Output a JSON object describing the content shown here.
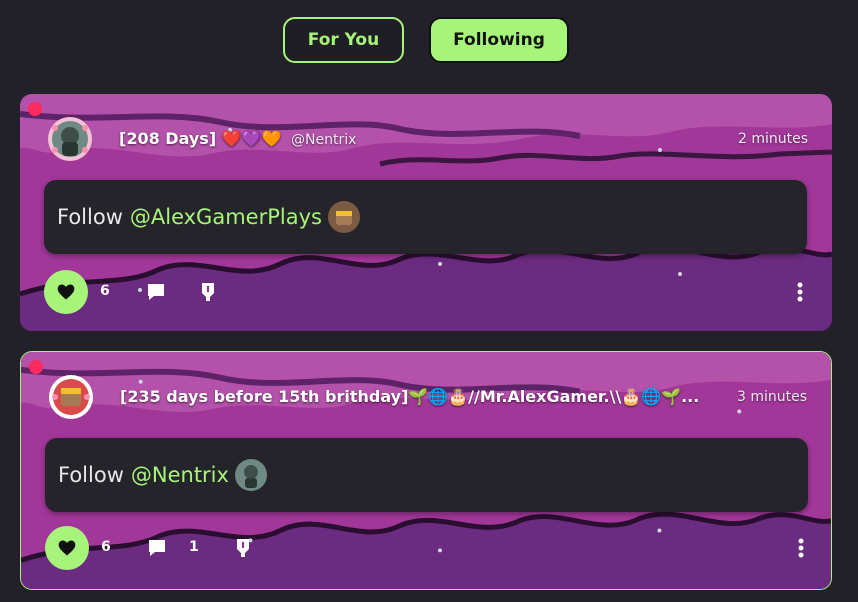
{
  "tabs": [
    {
      "label": "For You"
    },
    {
      "label": "Following"
    }
  ],
  "posts": [
    {
      "username": "[208 Days] ❤️💜🧡",
      "handle": "@Nentrix",
      "time": "2 minutes",
      "content_prefix": "Follow",
      "mention": "@AlexGamerPlays",
      "likes": "6",
      "comments": ""
    },
    {
      "username": "[235 days before 15th brithday]🌱🌐🎂//Mr.AlexGamer.\\\\🎂🌐🌱...",
      "handle": "",
      "time": "3 minutes",
      "content_prefix": "Follow",
      "mention": "@Nentrix",
      "likes": "6",
      "comments": "1"
    }
  ],
  "colors": {
    "accent": "#a6f57a",
    "background": "#222028",
    "card_content": "#26242b",
    "online_dot": "#ff2a5e",
    "banner_purple": "#a2379a"
  },
  "icons": [
    "heart-icon",
    "comment-icon",
    "repost-icon",
    "more-icon"
  ]
}
